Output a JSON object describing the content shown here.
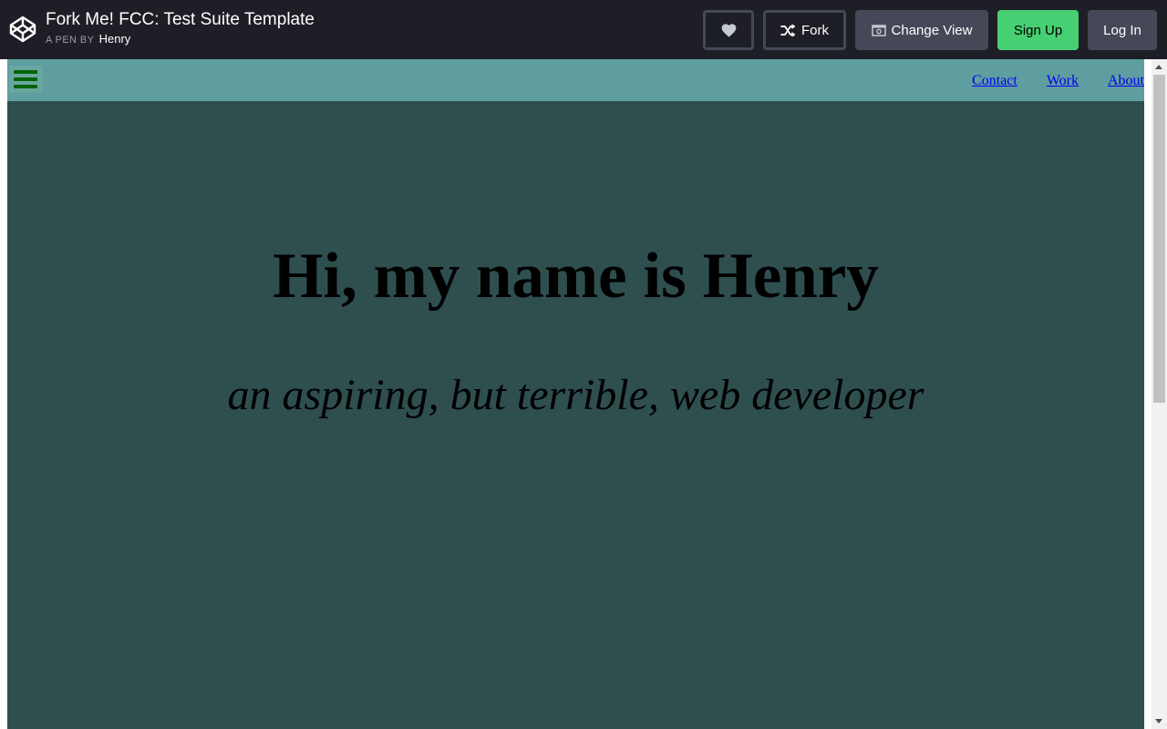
{
  "header": {
    "title": "Fork Me! FCC: Test Suite Template",
    "byline_prefix": "A PEN BY",
    "author": "Henry",
    "buttons": {
      "fork": "Fork",
      "change_view": "Change View",
      "sign_up": "Sign Up",
      "log_in": "Log In"
    },
    "colors": {
      "background": "#1e1f26",
      "button": "#444857",
      "signup": "#47cf73"
    }
  },
  "preview": {
    "nav": {
      "links": [
        "Contact",
        "Work",
        "About"
      ]
    },
    "hero": {
      "title": "Hi, my name is Henry",
      "subtitle": "an aspiring, but terrible, web developer"
    },
    "colors": {
      "background": "#2f4f4f",
      "nav": "#5f9ea0",
      "hamburger": "#006400"
    }
  },
  "icons": {
    "logo": "codepen-logo-icon",
    "heart": "heart-icon",
    "fork": "fork-icon",
    "change_view": "change-view-icon",
    "menu": "hamburger-menu-icon"
  }
}
